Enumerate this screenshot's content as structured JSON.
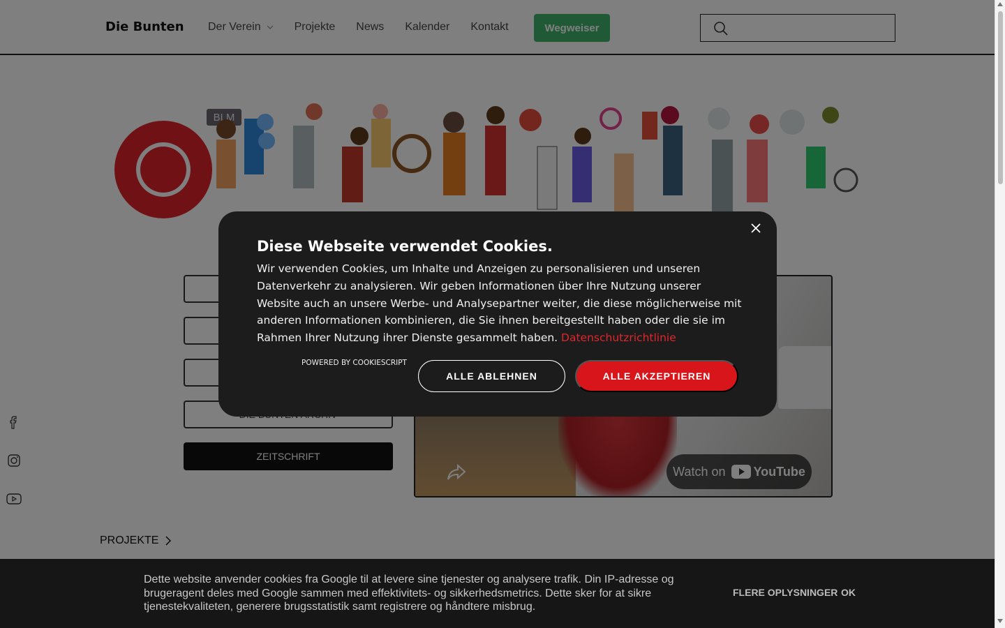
{
  "header": {
    "brand": "Die Bunten",
    "nav": [
      {
        "label": "Der Verein",
        "has_dropdown": true
      },
      {
        "label": "Projekte"
      },
      {
        "label": "News"
      },
      {
        "label": "Kalender"
      },
      {
        "label": "Kontakt"
      }
    ],
    "cta_label": "Wegweiser",
    "cta_color": "#3fb36b",
    "search_icon": "search-icon"
  },
  "hero": {
    "badge": "BLM"
  },
  "side_buttons": {
    "b4_label": "DIE BUNTEN ARCHIV",
    "b5_label": "ZEITSCHRIFT"
  },
  "video": {
    "watch_on": "Watch on",
    "youtube": "YouTube"
  },
  "social": [
    "facebook-icon",
    "instagram-icon",
    "youtube-icon"
  ],
  "section": {
    "projekte": "PROJEKTE"
  },
  "cookie_modal": {
    "title": "Diese Webseite verwendet Cookies.",
    "body": "Wir verwenden Cookies, um Inhalte und Anzeigen zu personalisieren und unseren Datenverkehr zu analysieren. Wir geben Informationen über Ihre Nutzung unserer Website auch an unsere Werbe- und Analysepartner weiter, die diese möglicherweise mit anderen Informationen kombinieren, die Sie ihnen bereitgestellt haben oder die sie im Rahmen Ihrer Nutzung ihrer Dienste gesammelt haben.",
    "link": "Datenschutzrichtlinie",
    "powered": "POWERED BY COOKIESCRIPT",
    "reject": "ALLE ABLEHNEN",
    "accept": "ALLE AKZEPTIEREN",
    "accent": "#d7151b"
  },
  "google_bar": {
    "text": "Dette website anvender cookies fra Google til at levere sine tjenester og analysere trafik. Din IP-adresse og brugeragent deles med Google sammen med effektivitets- og sikkerhedsmetrics. Dette sker for at sikre tjenestekvaliteten, generere brugsstatistik samt registrere og håndtere misbrug.",
    "more": "FLERE OPLYSNINGER",
    "ok": "OK"
  }
}
